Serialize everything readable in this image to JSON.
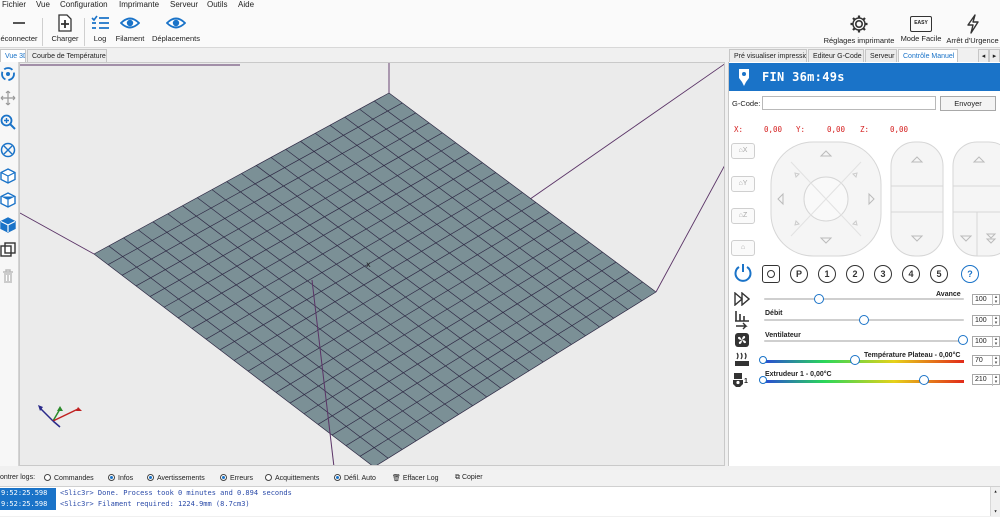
{
  "menu": [
    "Fichier",
    "Vue",
    "Configuration",
    "Imprimante",
    "Serveur",
    "Outils",
    "Aide"
  ],
  "toolbar": {
    "disconnect": "éconnecter",
    "load": "Charger",
    "log": "Log",
    "filament": "Filament",
    "moves": "Déplacements",
    "printer_settings": "Réglages imprimante",
    "easy_mode": "Mode Facile",
    "easy_badge": "EASY",
    "emergency_stop": "Arrêt d'Urgence"
  },
  "left_tabs": [
    "Vue 3D",
    "Courbe de Température"
  ],
  "right_tabs": [
    "Pré visualiser impression",
    "Editeur G-Code",
    "Serveur",
    "Contrôle Manuel"
  ],
  "status": {
    "text": "FIN 36m:49s"
  },
  "gcode": {
    "label": "G-Code:",
    "value": "",
    "send": "Envoyer"
  },
  "coords": {
    "x_label": "X:",
    "x": "0,00",
    "y_label": "Y:",
    "y": "0,00",
    "z_label": "Z:",
    "z": "0,00"
  },
  "home_buttons": [
    "X",
    "Y",
    "Z",
    ""
  ],
  "quick_buttons": [
    "P",
    "1",
    "2",
    "3",
    "4",
    "5",
    "?"
  ],
  "sliders": {
    "speed": {
      "label": "Avance",
      "value": "100",
      "level": 100
    },
    "flow": {
      "label": "Débit",
      "value": "100",
      "level": 100
    },
    "fan": {
      "label": "Ventilateur",
      "value": "100",
      "level": 100
    },
    "bed": {
      "label": "Température Plateau - 0,00°C",
      "value": "70"
    },
    "extruder": {
      "label": "Extrudeur 1 - 0,00°C",
      "value": "210"
    }
  },
  "extruder_index": "1",
  "viewport": {
    "origin_marker": "x"
  },
  "log": {
    "show_label": "ontrer logs:",
    "options": [
      {
        "label": "Commandes",
        "on": false
      },
      {
        "label": "Infos",
        "on": true
      },
      {
        "label": "Avertissements",
        "on": true
      },
      {
        "label": "Erreurs",
        "on": true
      },
      {
        "label": "Acquittements",
        "on": false
      },
      {
        "label": "Défil. Auto",
        "on": true
      }
    ],
    "clear": "Effacer Log",
    "copy": "Copier",
    "lines": [
      {
        "time": "9:52:25.598",
        "msg": "<Slic3r> Done. Process took 0 minutes and 0.894 seconds"
      },
      {
        "time": "9:52:25.598",
        "msg": "<Slic3r> Filament required: 1224.9mm (8.7cm3)"
      }
    ]
  },
  "colors": {
    "accent": "#1a73c8",
    "bed": "#7b9096",
    "coords": "#d52020",
    "frame": "#5a3366"
  }
}
